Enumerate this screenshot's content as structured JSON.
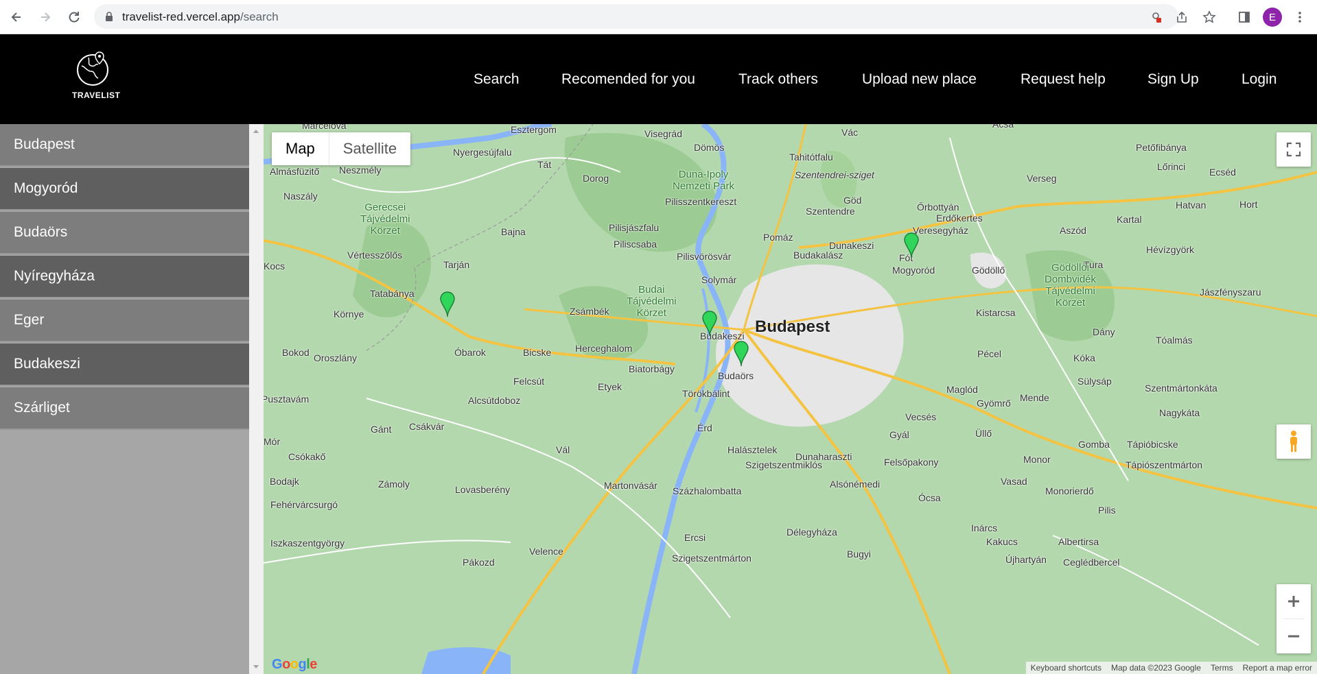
{
  "browser": {
    "url_host": "travelist-red.vercel.app",
    "url_path": "/search",
    "profile_initial": "E"
  },
  "header": {
    "logo_text": "TRAVELIST",
    "nav": [
      {
        "label": "Search"
      },
      {
        "label": "Recomended for you"
      },
      {
        "label": "Track others"
      },
      {
        "label": "Upload new place"
      },
      {
        "label": "Request help"
      },
      {
        "label": "Sign Up"
      },
      {
        "label": "Login"
      }
    ]
  },
  "sidebar": {
    "items": [
      {
        "label": "Budapest"
      },
      {
        "label": "Mogyoród"
      },
      {
        "label": "Budaörs"
      },
      {
        "label": "Nyíregyháza"
      },
      {
        "label": "Eger"
      },
      {
        "label": "Budakeszi"
      },
      {
        "label": "Szárliget"
      }
    ]
  },
  "map": {
    "type_buttons": {
      "map": "Map",
      "satellite": "Satellite"
    },
    "city_label": "Budapest",
    "places": [
      "Marcelová",
      "Esztergom",
      "Visegrád",
      "Vác",
      "Acsa",
      "Petőfibánya",
      "Lőrinci",
      "Ecséd",
      "Nyergesújfalu",
      "Dömös",
      "Tahitótfalu",
      "Almásfüzitő",
      "Neszmély",
      "Tát",
      "Dorog",
      "Verseg",
      "Naszály",
      "Pilisszentkereszt",
      "Szentendre",
      "Göd",
      "Őrbottyán",
      "Erdőkertes",
      "Hort",
      "Hatvan",
      "Bajna",
      "Pilisjászfalu",
      "Veresegyház",
      "Aszód",
      "Kartal",
      "Vértesszőlős",
      "Piliscsaba",
      "Pomáz",
      "Dunakeszi",
      "Hévízgyörk",
      "Tarján",
      "Pilisvörösvár",
      "Budakalász",
      "Fót",
      "Mogyoród",
      "Gödöllő",
      "Tura",
      "Kocs",
      "Solymár",
      "Tatabánya",
      "Jászfényszaru",
      "Zsámbék",
      "Kistarcsa",
      "Környe",
      "Budakeszi",
      "Dány",
      "Tóalmás",
      "Bokod",
      "Óbarok",
      "Bicske",
      "Herceghalom",
      "Pécel",
      "Kóka",
      "Oroszlány",
      "Biatorbágy",
      "Budaörs",
      "Felcsút",
      "Etyek",
      "Törökbálint",
      "Maglód",
      "Gyömrő",
      "Mende",
      "Sülysáp",
      "Szentmártonkáta",
      "Pusztavám",
      "Alcsútdoboz",
      "Vecsés",
      "Nagykáta",
      "Érd",
      "Gánt",
      "Csákvár",
      "Üllő",
      "Gyál",
      "Mór",
      "Gomba",
      "Vál",
      "Halásztelek",
      "Tápióbicske",
      "Csókakő",
      "Dunaharaszti",
      "Felsőpakony",
      "Monor",
      "Szigetszentmiklós",
      "Tápiószentmárton",
      "Bodajk",
      "Zámoly",
      "Alsónémedi",
      "Vasad",
      "Martonvásár",
      "Lovasberény",
      "Monorierdő",
      "Százhalombatta",
      "Ócsa",
      "Fehérvárcsurgó",
      "Pilis",
      "Inárcs",
      "Kakucs",
      "Albertirsa",
      "Iszkaszentgyörgy",
      "Ercsi",
      "Délegyháza",
      "Velence",
      "Újhartyán",
      "Szigetszentmárton",
      "Bugyi",
      "Pákozd",
      "Ceglédbercel"
    ],
    "parks": [
      "Gerecsei\nTájvédelmi\nKörzet",
      "Duna-Ipoly\nNemzeti Park",
      "Budai\nTájvédelmi\nKörzet",
      "Gödöllői\nDombvidék\nTájvédelmi\nKörzet"
    ],
    "island_label": "Szentendrei-sziget",
    "zoom_in": "+",
    "zoom_out": "−",
    "google_logo": "Google",
    "attribution": {
      "shortcuts": "Keyboard shortcuts",
      "data": "Map data ©2023 Google",
      "terms": "Terms",
      "report": "Report a map error"
    },
    "colors": {
      "land": "#b4d8ae",
      "forest": "#9ccc93",
      "urban": "#e6e6e6",
      "water": "#8ab4f8",
      "road_major": "#f5c342",
      "marker": "#2fd65a"
    }
  }
}
